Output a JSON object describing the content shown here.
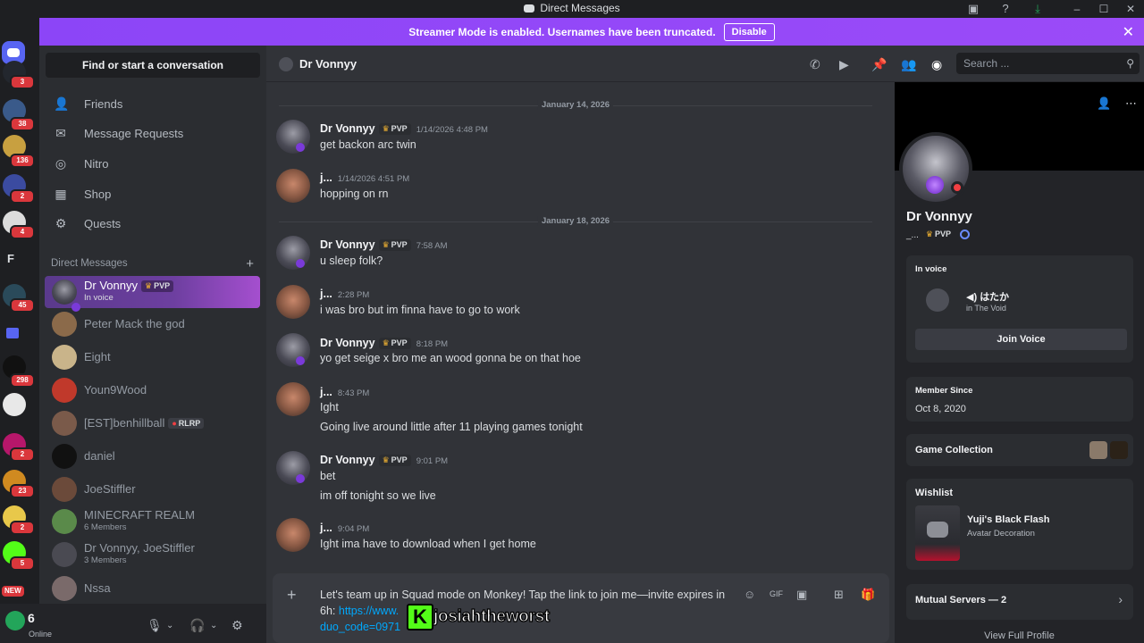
{
  "window": {
    "title": "Direct Messages"
  },
  "banner": {
    "text": "Streamer Mode is enabled. Usernames have been truncated.",
    "disable_label": "Disable"
  },
  "rail": {
    "servers": [
      {
        "badge": "3"
      },
      {
        "badge": "38"
      },
      {
        "badge": "136"
      },
      {
        "badge": "2"
      },
      {
        "badge": "4"
      },
      {
        "letter": "F"
      },
      {
        "badge": "45"
      },
      {
        "badge": ""
      },
      {
        "badge": "298"
      },
      {
        "badge": ""
      },
      {
        "badge": "2"
      },
      {
        "badge": "23"
      },
      {
        "badge": "2"
      },
      {
        "badge": "5"
      },
      {
        "badge": "NEW"
      }
    ]
  },
  "sidebar": {
    "find_label": "Find or start a conversation",
    "nav": [
      {
        "label": "Friends",
        "icon": "friends-icon"
      },
      {
        "label": "Message Requests",
        "icon": "mail-icon"
      },
      {
        "label": "Nitro",
        "icon": "nitro-icon"
      },
      {
        "label": "Shop",
        "icon": "shop-icon"
      },
      {
        "label": "Quests",
        "icon": "quests-icon"
      }
    ],
    "dm_header": "Direct Messages",
    "dms": [
      {
        "name": "Dr Vonnyy",
        "tag": "PVP",
        "sub": "In voice",
        "active": true
      },
      {
        "name": "Peter Mack the god"
      },
      {
        "name": "Eight"
      },
      {
        "name": "Youn9Wood"
      },
      {
        "name": "[EST]benhillball",
        "tag": "RLRP"
      },
      {
        "name": "daniel"
      },
      {
        "name": "JoeStiffler"
      },
      {
        "name": "MINECRAFT REALM",
        "sub": "6 Members"
      },
      {
        "name": "Dr Vonnyy, JoeStiffler",
        "sub": "3 Members"
      },
      {
        "name": "Nssa"
      }
    ]
  },
  "user": {
    "name": "6",
    "status": "Online"
  },
  "chat": {
    "header_name": "Dr Vonnyy",
    "search_placeholder": "Search ...",
    "dividers": [
      "January 14, 2026",
      "January 18, 2026"
    ],
    "messages": [
      {
        "author": "Dr Vonnyy",
        "tag": "PVP",
        "time": "1/14/2026 4:48 PM",
        "lines": [
          "get backon arc twin"
        ]
      },
      {
        "author": "j...",
        "time": "1/14/2026 4:51 PM",
        "lines": [
          "hopping on rn"
        ]
      },
      {
        "author": "Dr Vonnyy",
        "tag": "PVP",
        "time": "7:58 AM",
        "lines": [
          "u sleep folk?"
        ]
      },
      {
        "author": "j...",
        "time": "2:28 PM",
        "lines": [
          "i was bro but im finna have to go to work"
        ]
      },
      {
        "author": "Dr Vonnyy",
        "tag": "PVP",
        "time": "8:18 PM",
        "lines": [
          "yo get seige x bro me an wood gonna be on that hoe"
        ]
      },
      {
        "author": "j...",
        "time": "8:43 PM",
        "lines": [
          "Ight",
          "Going live around little after 11 playing games tonight"
        ]
      },
      {
        "author": "Dr Vonnyy",
        "tag": "PVP",
        "time": "9:01 PM",
        "lines": [
          "bet",
          "im off tonight so we live"
        ]
      },
      {
        "author": "j...",
        "time": "9:04 PM",
        "lines": [
          "Ight ima have to download when I get home"
        ]
      }
    ],
    "composer": {
      "text": "Let's team up in Squad mode on Monkey! Tap the link to join me—invite expires in 6h:",
      "link": "https://www.",
      "link2": "duo_code=0971"
    },
    "overlay_name": "josiahtheworst"
  },
  "profile": {
    "name": "Dr Vonnyy",
    "sub": "_...",
    "tag": "PVP",
    "in_voice_title": "In voice",
    "voice_channel": "はたか",
    "voice_location": "in The Void",
    "join_label": "Join Voice",
    "member_since_title": "Member Since",
    "member_since": "Oct 8, 2020",
    "game_collection": "Game Collection",
    "wishlist_title": "Wishlist",
    "wishlist_item": "Yuji's Black Flash",
    "wishlist_sub": "Avatar Decoration",
    "mutual_servers": "Mutual Servers — 2",
    "view_full": "View Full Profile"
  }
}
